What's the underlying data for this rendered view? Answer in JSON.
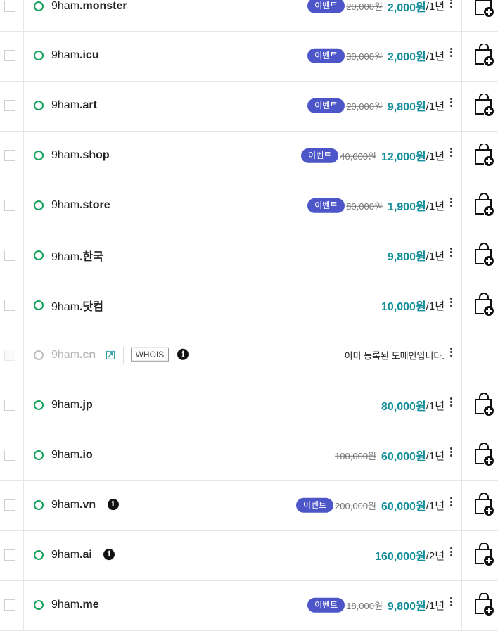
{
  "rows": [
    {
      "name": "9ham",
      "tld": ".monster",
      "status": "available",
      "event": "이벤트",
      "old_price": "20,000원",
      "price": "2,000원",
      "period": "/1년",
      "info": false
    },
    {
      "name": "9ham",
      "tld": ".icu",
      "status": "available",
      "event": "이벤트",
      "old_price": "30,000원",
      "price": "2,000원",
      "period": "/1년",
      "info": false
    },
    {
      "name": "9ham",
      "tld": ".art",
      "status": "available",
      "event": "이벤트",
      "old_price": "20,000원",
      "price": "9,800원",
      "period": "/1년",
      "info": false
    },
    {
      "name": "9ham",
      "tld": ".shop",
      "status": "available",
      "event": "이벤트",
      "old_price": "40,000원",
      "price": "12,000원",
      "period": "/1년",
      "info": false
    },
    {
      "name": "9ham",
      "tld": ".store",
      "status": "available",
      "event": "이벤트",
      "old_price": "80,000원",
      "price": "1,900원",
      "period": "/1년",
      "info": false
    },
    {
      "name": "9ham",
      "tld": ".한국",
      "status": "available",
      "event": "",
      "old_price": "",
      "price": "9,800원",
      "period": "/1년",
      "info": false
    },
    {
      "name": "9ham",
      "tld": ".닷컴",
      "status": "available",
      "event": "",
      "old_price": "",
      "price": "10,000원",
      "period": "/1년",
      "info": false
    },
    {
      "name": "9ham",
      "tld": ".cn",
      "status": "taken",
      "whois_label": "WHOIS",
      "taken_text": "이미 등록된 도메인입니다.",
      "info": true
    },
    {
      "name": "9ham",
      "tld": ".jp",
      "status": "available",
      "event": "",
      "old_price": "",
      "price": "80,000원",
      "period": "/1년",
      "info": false
    },
    {
      "name": "9ham",
      "tld": ".io",
      "status": "available",
      "event": "",
      "old_price": "100,000원",
      "price": "60,000원",
      "period": "/1년",
      "info": false
    },
    {
      "name": "9ham",
      "tld": ".vn",
      "status": "available",
      "event": "이벤트",
      "old_price": "200,000원",
      "price": "60,000원",
      "period": "/1년",
      "info": true
    },
    {
      "name": "9ham",
      "tld": ".ai",
      "status": "available",
      "event": "",
      "old_price": "",
      "price": "160,000원",
      "period": "/2년",
      "info": true
    },
    {
      "name": "9ham",
      "tld": ".me",
      "status": "available",
      "event": "이벤트",
      "old_price": "18,000원",
      "price": "9,800원",
      "period": "/1년",
      "info": false
    }
  ],
  "icons": {
    "status_available": "circle-outline-green",
    "status_taken": "circle-outline-gray",
    "info": "info-icon",
    "more": "kebab-menu-icon",
    "cart": "add-to-cart-bag-icon",
    "external": "external-link-icon"
  },
  "colors": {
    "price": "#148f9a",
    "event_badge": "#4d56c8",
    "available": "#12a15a",
    "taken": "#bdbdbd"
  },
  "info_glyph": "i"
}
